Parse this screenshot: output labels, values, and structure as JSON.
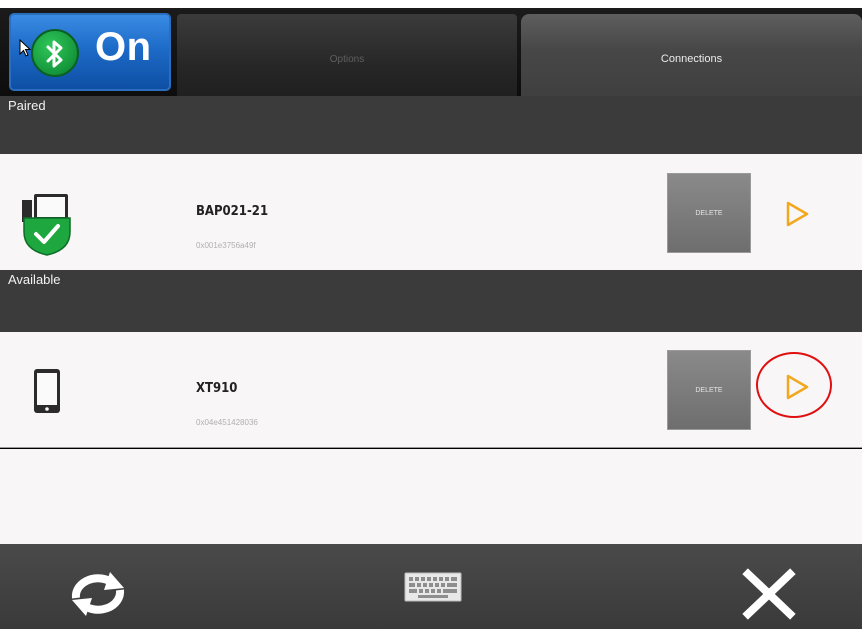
{
  "toggle": {
    "label": "On",
    "icon": "bluetooth-icon",
    "state": "on"
  },
  "tabs": [
    {
      "label": "Options",
      "active": false
    },
    {
      "label": "Connections",
      "active": true
    }
  ],
  "sections": {
    "paired": "Paired",
    "available": "Available"
  },
  "paired_devices": [
    {
      "name": "BAP021-21",
      "address": "0x001e3756a49f",
      "delete_label": "DELETE",
      "icon": "paired-device-check-icon"
    }
  ],
  "available_devices": [
    {
      "name": "XT910",
      "address": "0x04e451428036",
      "delete_label": "DELETE",
      "icon": "phone-icon"
    }
  ],
  "bottom_bar": {
    "refresh_icon": "refresh-icon",
    "keyboard_icon": "keyboard-icon",
    "close_icon": "close-icon"
  },
  "colors": {
    "toggle_blue": "#1d6bc8",
    "bluetooth_green": "#14953a",
    "arrow_orange": "#f2a81d",
    "highlight_red": "#e01010",
    "header_gray": "#3b3b3b"
  }
}
